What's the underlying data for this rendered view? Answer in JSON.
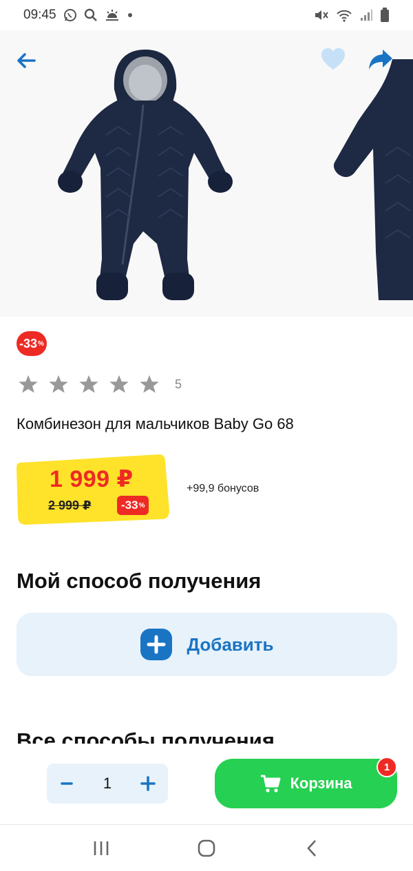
{
  "status_bar": {
    "time": "09:45",
    "left_icons": [
      "whatsapp-icon",
      "search-icon",
      "weather-icon",
      "dot-icon"
    ],
    "right_icons": [
      "mute-icon",
      "wifi-icon",
      "signal-icon",
      "battery-icon"
    ]
  },
  "gallery": {
    "icons": [
      "back-arrow-icon",
      "heart-icon",
      "share-icon"
    ],
    "image_alt": ""
  },
  "product": {
    "discount_badge": "-33",
    "discount_badge_unit": "%",
    "rating_stars": 5,
    "rating_filled": 0,
    "rating_count": "5",
    "title": "Комбинезон для мальчиков Baby Go 68",
    "price": "1 999 ₽",
    "old_price": "2 999 ₽",
    "price_discount": "-33",
    "price_discount_unit": "%",
    "bonus": "+99,9 бонусов"
  },
  "delivery": {
    "my_method_title": "Мой способ получения",
    "add_label": "Добавить",
    "all_methods_title": "Все способы получения"
  },
  "action_bar": {
    "quantity": "1",
    "cart_label": "Корзина",
    "cart_count": "1"
  },
  "colors": {
    "accent_blue": "#1a74c4",
    "price_red": "#ee2a24",
    "price_yellow": "#ffe22a",
    "cart_green": "#26d052",
    "light_blue_bg": "#e7f2fb"
  }
}
